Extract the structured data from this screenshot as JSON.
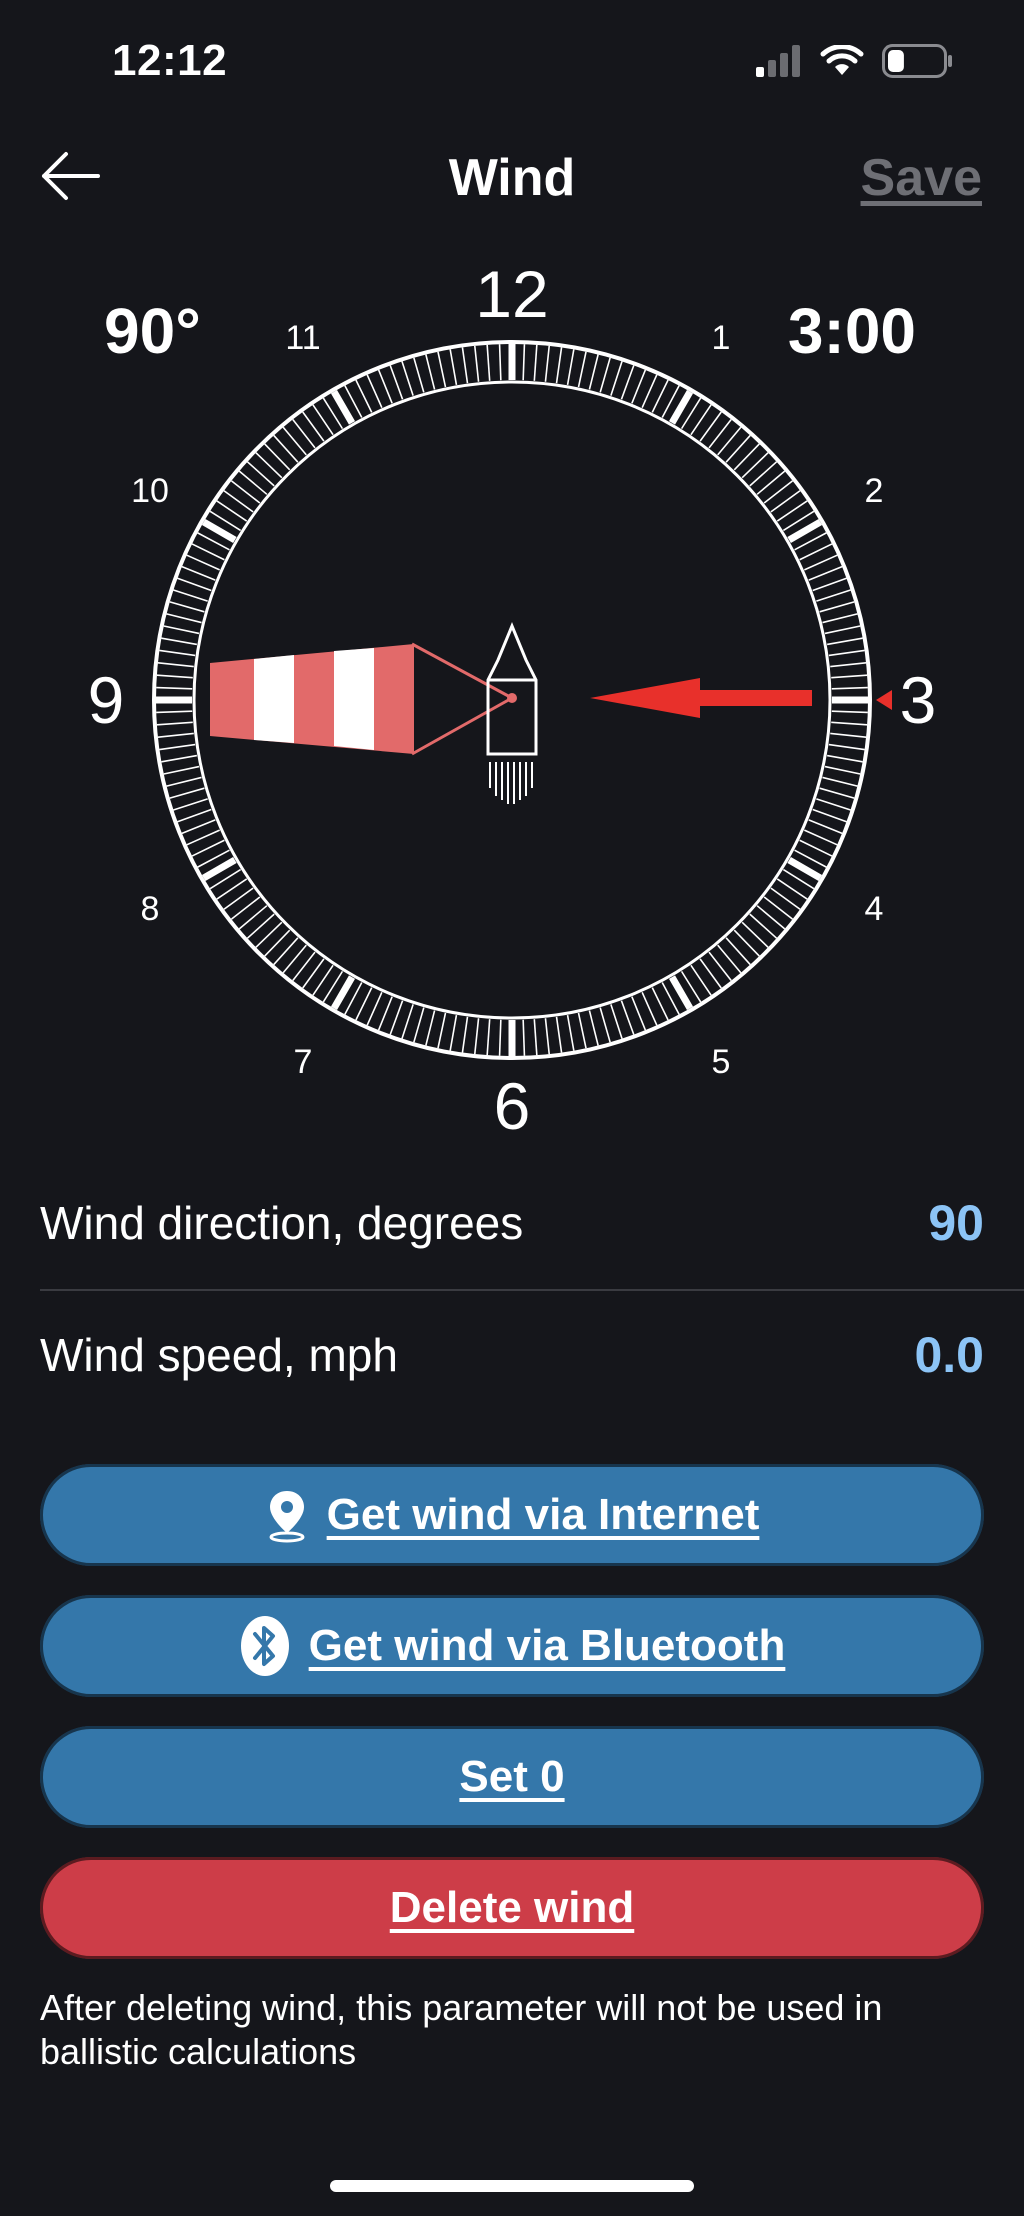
{
  "status": {
    "time": "12:12",
    "battery_level": 0.3
  },
  "nav": {
    "title": "Wind",
    "save_label": "Save",
    "back_icon": "arrow-left-icon"
  },
  "dial": {
    "degrees": "90°",
    "clock": "3:00",
    "hour_labels": [
      "12",
      "1",
      "2",
      "3",
      "4",
      "5",
      "6",
      "7",
      "8",
      "9",
      "10",
      "11"
    ],
    "wind_direction_deg": 90
  },
  "rows": [
    {
      "label": "Wind direction, degrees",
      "value": "90"
    },
    {
      "label": "Wind speed, mph",
      "value": "0.0"
    }
  ],
  "buttons": {
    "internet": {
      "label": "Get wind via Internet",
      "icon": "location-pin-icon"
    },
    "bluetooth": {
      "label": "Get wind via Bluetooth",
      "icon": "bluetooth-icon"
    },
    "set_zero": {
      "label": "Set 0"
    },
    "delete": {
      "label": "Delete wind"
    }
  },
  "footnote": "After deleting wind, this parameter will not be used in ballistic calculations",
  "colors": {
    "accent_blue": "#3477aa",
    "accent_red": "#cd3d48",
    "value_blue": "#8cc4f6",
    "windsock_red": "#e26a6a",
    "arrow_red": "#e8302b"
  }
}
